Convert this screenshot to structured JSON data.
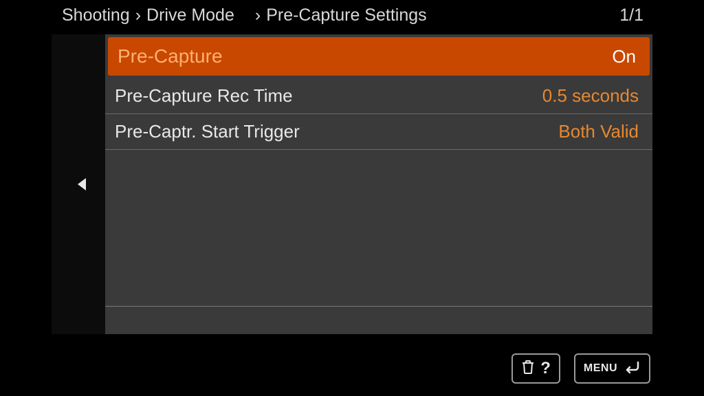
{
  "breadcrumb": {
    "level1": "Shooting",
    "level2": "Drive Mode",
    "level3": "Pre-Capture Settings"
  },
  "page_indicator": "1/1",
  "menu": {
    "items": [
      {
        "label": "Pre-Capture",
        "value": "On",
        "selected": true
      },
      {
        "label": "Pre-Capture Rec Time",
        "value": "0.5 seconds",
        "selected": false
      },
      {
        "label": "Pre-Captr. Start Trigger",
        "value": "Both Valid",
        "selected": false
      }
    ]
  },
  "footer": {
    "help_symbol": "?",
    "menu_label": "MENU"
  }
}
